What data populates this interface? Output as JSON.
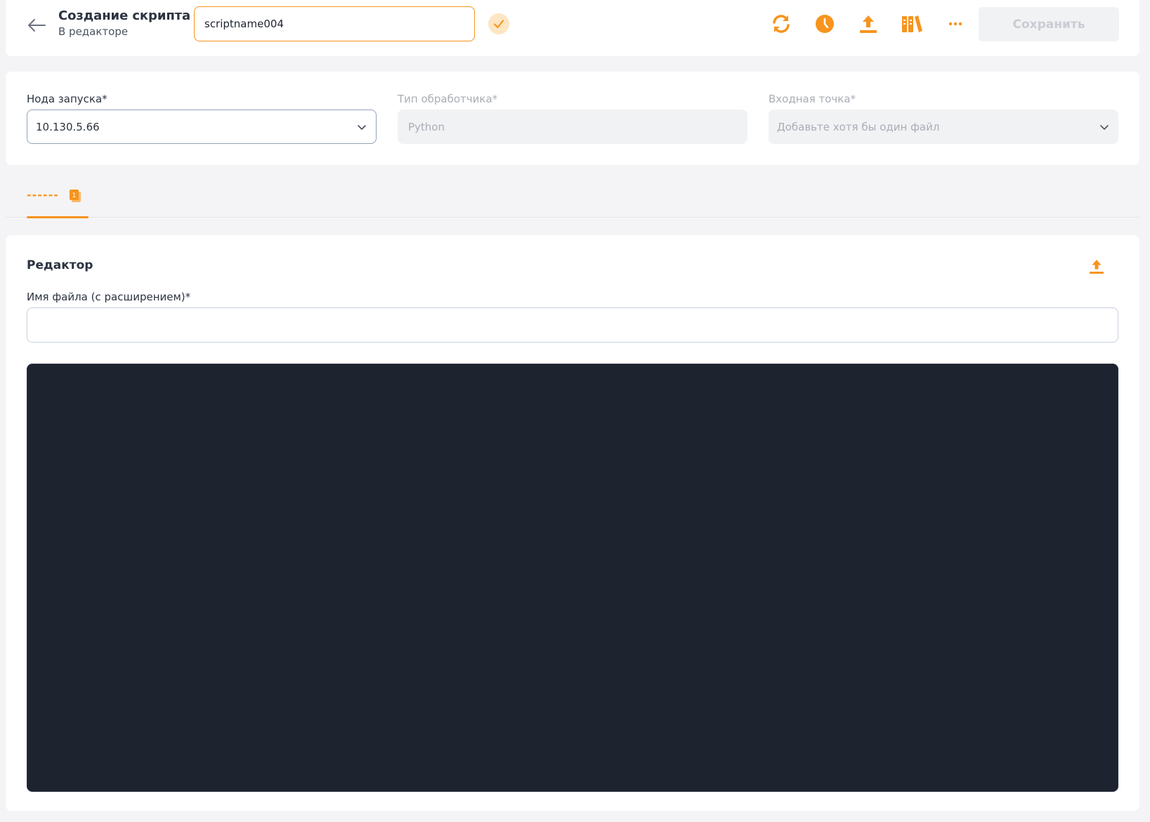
{
  "header": {
    "title": "Создание скрипта",
    "subtitle": "В редакторе",
    "script_name_value": "scriptname004",
    "save_label": "Сохранить"
  },
  "settings": {
    "node": {
      "label": "Нода запуска*",
      "value": "10.130.5.66"
    },
    "handler": {
      "label": "Тип обработчика*",
      "value": "Python"
    },
    "entry": {
      "label": "Входная точка*",
      "placeholder": "Добавьте хотя бы один файл"
    }
  },
  "tabs": [
    {
      "label": "------",
      "badge": "1",
      "active": true
    }
  ],
  "editor": {
    "title": "Редактор",
    "filename_label": "Имя файла (с расширением)*",
    "filename_value": ""
  },
  "icons": {
    "back": "arrow-left-icon",
    "confirm": "check-icon",
    "refresh": "refresh-icon",
    "history": "clock-icon",
    "upload": "upload-icon",
    "library": "library-icon",
    "more": "more-icon",
    "chevron": "chevron-down-icon",
    "tab_badge": "file-badge-icon"
  },
  "colors": {
    "accent": "#f7941d",
    "accent_light": "#fde6c4",
    "code_background": "#1e2330",
    "page_background": "#f4f4f6"
  }
}
